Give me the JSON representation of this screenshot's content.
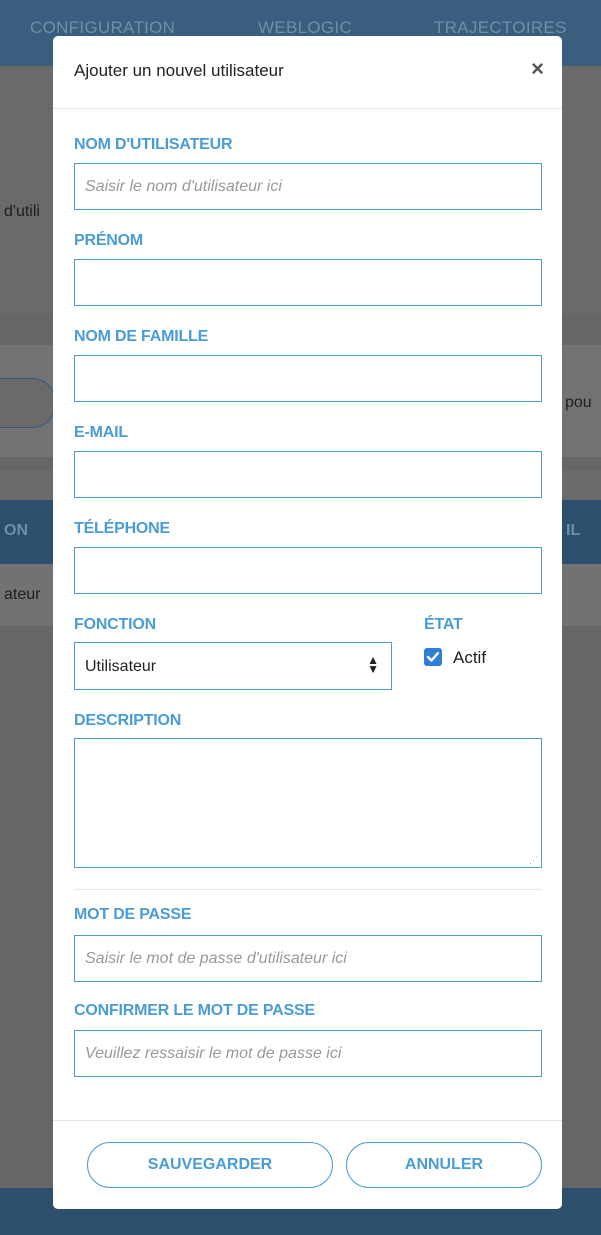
{
  "background": {
    "nav_items": [
      "CONFIGURATION",
      "WEBLOGIC",
      "TRAJECTOIRES"
    ],
    "fragment_left_1": "d'utili",
    "fragment_right_1": "pou",
    "table_head_left": "ON",
    "table_head_right": "IL",
    "row_fragment": "ateur"
  },
  "modal": {
    "title": "Ajouter un nouvel utilisateur",
    "close_label": "×",
    "fields": {
      "username": {
        "label": "NOM D'UTILISATEUR",
        "placeholder": "Saisir le nom d'utilisateur ici",
        "value": ""
      },
      "firstname": {
        "label": "PRÉNOM",
        "placeholder": "",
        "value": ""
      },
      "lastname": {
        "label": "NOM DE FAMILLE",
        "placeholder": "",
        "value": ""
      },
      "email": {
        "label": "E-MAIL",
        "placeholder": "",
        "value": ""
      },
      "phone": {
        "label": "TÉLÉPHONE",
        "placeholder": "",
        "value": ""
      },
      "function": {
        "label": "FONCTION",
        "selected": "Utilisateur"
      },
      "state": {
        "label": "ÉTAT",
        "checkbox_label": "Actif",
        "checked": true
      },
      "description": {
        "label": "DESCRIPTION",
        "value": ""
      },
      "password": {
        "label": "MOT DE PASSE",
        "placeholder": "Saisir le mot de passe d'utilisateur ici"
      },
      "confirm_password": {
        "label": "CONFIRMER LE MOT DE PASSE",
        "placeholder": "Veuillez ressaisir le mot de passe ici"
      }
    },
    "buttons": {
      "save": "SAUVEGARDER",
      "cancel": "ANNULER"
    }
  },
  "colors": {
    "accent": "#4a9cd6",
    "checkbox": "#2f7fd6",
    "nav": "#3a5f7e"
  }
}
